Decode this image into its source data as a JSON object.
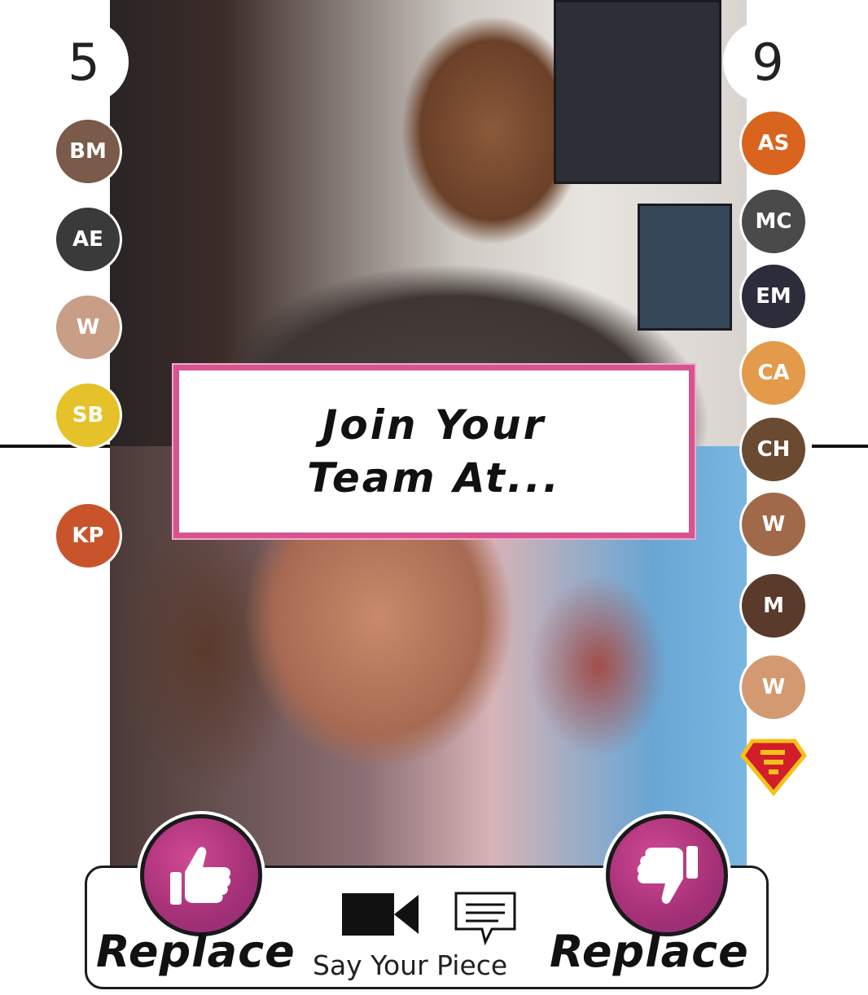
{
  "scores": {
    "left": "5",
    "right": "9"
  },
  "banner": {
    "line1": "Join Your",
    "line2": "Team At..."
  },
  "bottom_bar": {
    "left_button_label": "Replace",
    "center_label": "Say Your Piece",
    "right_button_label": "Replace"
  },
  "team_left": [
    {
      "initials": "BM",
      "color": "#7a5a48"
    },
    {
      "initials": "AE",
      "color": "#3a3a3a"
    },
    {
      "initials": "W",
      "color": "#c89e86"
    },
    {
      "initials": "SB",
      "color": "#e6c22a"
    },
    {
      "initials": "KP",
      "color": "#c9542c"
    }
  ],
  "team_right": [
    {
      "initials": "AS",
      "color": "#d8641e"
    },
    {
      "initials": "MC",
      "color": "#4a4a4a"
    },
    {
      "initials": "EM",
      "color": "#2c2c3a"
    },
    {
      "initials": "CA",
      "color": "#e39a4a"
    },
    {
      "initials": "CH",
      "color": "#6a4a30"
    },
    {
      "initials": "W",
      "color": "#a06a4a"
    },
    {
      "initials": "M",
      "color": "#5a3a2a"
    },
    {
      "initials": "W",
      "color": "#d39a72"
    },
    {
      "initials": "S",
      "color": "#d21e2a"
    }
  ],
  "colors": {
    "accent_pink": "#d7548f",
    "button_purple": "#a83278"
  },
  "icons": {
    "video": "video-camera-icon",
    "chat": "chat-bubble-icon",
    "thumb": "thumbs-up-icon"
  }
}
